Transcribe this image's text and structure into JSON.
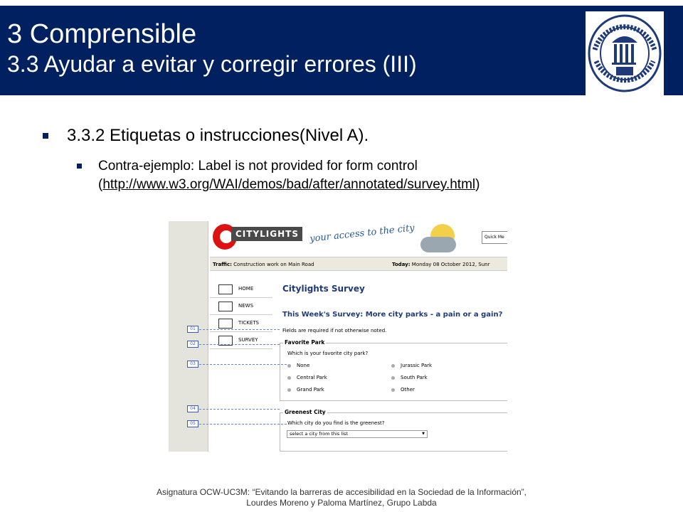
{
  "header": {
    "title_line1": "3 Comprensible",
    "title_line2": "3.3 Ayudar a evitar y corregir errores (III)",
    "seal_text_top": "UNIVERSIDAD",
    "seal_text_bottom": "CARLOS III DE MADRID",
    "seal_motto": "homo sacra res"
  },
  "content": {
    "bullet1": "3.3.2 Etiquetas o instrucciones(Nivel A).",
    "bullet2_text": "Contra-ejemplo: Label is not provided for form control",
    "bullet2_open": "(",
    "bullet2_link": "http://www.w3.org/WAI/demos/bad/after/annotated/survey.html",
    "bullet2_close": ")"
  },
  "screenshot": {
    "brand": "CITYLIGHTS",
    "slogan": "your access to the city",
    "quick_menu": "Quick Me",
    "traffic_label": "Traffic:",
    "traffic_text": "Construction work on Main Road",
    "today_label": "Today:",
    "today_text": "Monday 08 October 2012, Sunr",
    "nav": [
      "HOME",
      "NEWS",
      "TICKETS",
      "SURVEY"
    ],
    "survey_title": "Citylights Survey",
    "week_question": "This Week's Survey: More city parks - a pain or a gain?",
    "required_note": "Fields are required if not otherwise noted.",
    "fieldset1_legend": "Favorite Park",
    "fieldset1_question": "Which is your favorite city park?",
    "park_options": [
      "None",
      "Jurassic Park",
      "Central Park",
      "South Park",
      "Grand Park",
      "Other"
    ],
    "fieldset2_legend": "Greenest City",
    "fieldset2_question": "Which city do you find is the greenest?",
    "select_value": "select a city from this list",
    "markers": [
      "01",
      "02",
      "03",
      "04",
      "05"
    ]
  },
  "footer": {
    "line1": "Asignatura OCW-UC3M:   “Evitando la barreras de accesibilidad en la Sociedad de la Información”,",
    "line2": "Lourdes Moreno y Paloma Martínez,  Grupo Labda"
  },
  "colors": {
    "header_bg": "#002060",
    "bullet": "#002060"
  }
}
